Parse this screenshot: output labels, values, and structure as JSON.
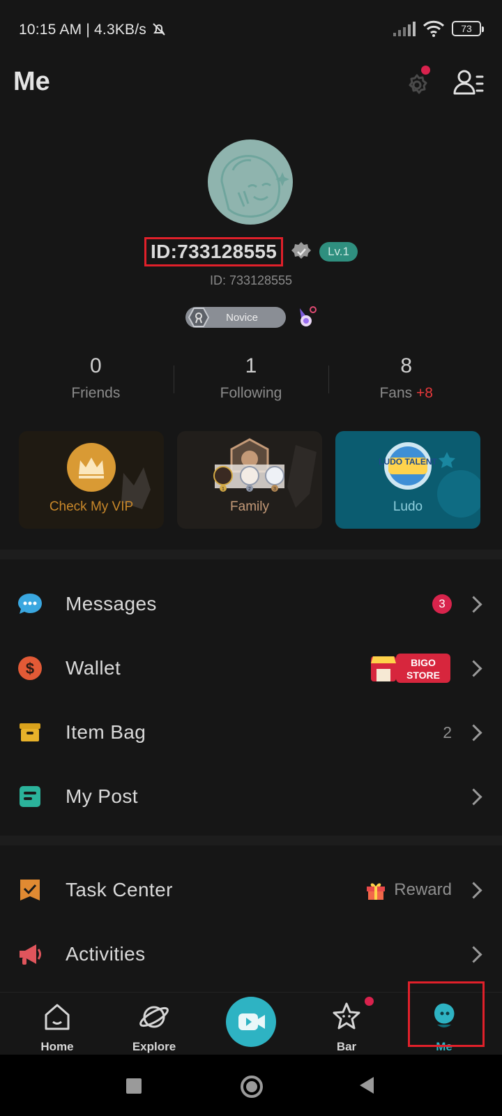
{
  "status_bar": {
    "time": "10:15 AM | 4.3KB/s",
    "battery": "73"
  },
  "header": {
    "title": "Me"
  },
  "profile": {
    "id_label": "ID:733128555",
    "level": "Lv.1",
    "sub_id": "ID: 733128555",
    "badge": "Novice"
  },
  "stats": [
    {
      "value": "0",
      "label": "Friends"
    },
    {
      "value": "1",
      "label": "Following"
    },
    {
      "value": "8",
      "label": "Fans",
      "delta": "+8"
    }
  ],
  "cards": [
    {
      "label": "Check My VIP",
      "color": "#c9882a"
    },
    {
      "label": "Family",
      "color": "#c49a78",
      "badge_numbers": [
        "1",
        "2",
        "3"
      ]
    },
    {
      "label": "Ludo",
      "color": "#8fd0de",
      "logo_text": "LUDO TALENT"
    }
  ],
  "menu_group_1": [
    {
      "label": "Messages",
      "badge": "3"
    },
    {
      "label": "Wallet",
      "promo": "BIGO STORE"
    },
    {
      "label": "Item Bag",
      "count": "2"
    },
    {
      "label": "My Post"
    }
  ],
  "menu_group_2": [
    {
      "label": "Task Center",
      "extra": "Reward"
    },
    {
      "label": "Activities"
    }
  ],
  "bottom_nav": [
    {
      "label": "Home"
    },
    {
      "label": "Explore"
    },
    {
      "label": ""
    },
    {
      "label": "Bar"
    },
    {
      "label": "Me",
      "active": true
    }
  ],
  "colors": {
    "accent": "#2eb3c3",
    "alert": "#d9224d",
    "highlight_box": "#e0202a"
  }
}
